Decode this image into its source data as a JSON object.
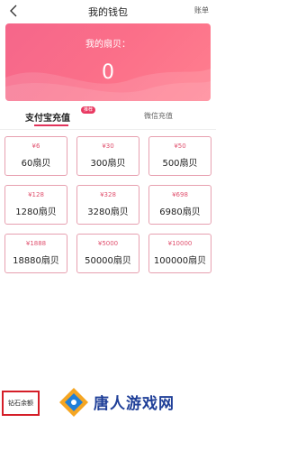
{
  "header": {
    "title": "我的钱包",
    "bill_label": "账单"
  },
  "balance": {
    "label": "我的扇贝：",
    "value": "0"
  },
  "tabs": {
    "alipay": "支付宝充值",
    "badge": "推荐",
    "wechat": "微信充值"
  },
  "options": [
    {
      "price": "¥6",
      "amount": "60扇贝"
    },
    {
      "price": "¥30",
      "amount": "300扇贝"
    },
    {
      "price": "¥50",
      "amount": "500扇贝"
    },
    {
      "price": "¥128",
      "amount": "1280扇贝"
    },
    {
      "price": "¥328",
      "amount": "3280扇贝"
    },
    {
      "price": "¥698",
      "amount": "6980扇贝"
    },
    {
      "price": "¥1888",
      "amount": "18880扇贝"
    },
    {
      "price": "¥5000",
      "amount": "50000扇贝"
    },
    {
      "price": "¥10000",
      "amount": "100000扇贝"
    }
  ],
  "footer": {
    "diamond_label": "钻石余额"
  },
  "watermark": {
    "text": "唐人游戏网"
  },
  "colors": {
    "accent": "#e2335b",
    "banner": "#fb6f89",
    "card_border": "#e7a0b0",
    "watermark": "#1f3f98"
  }
}
